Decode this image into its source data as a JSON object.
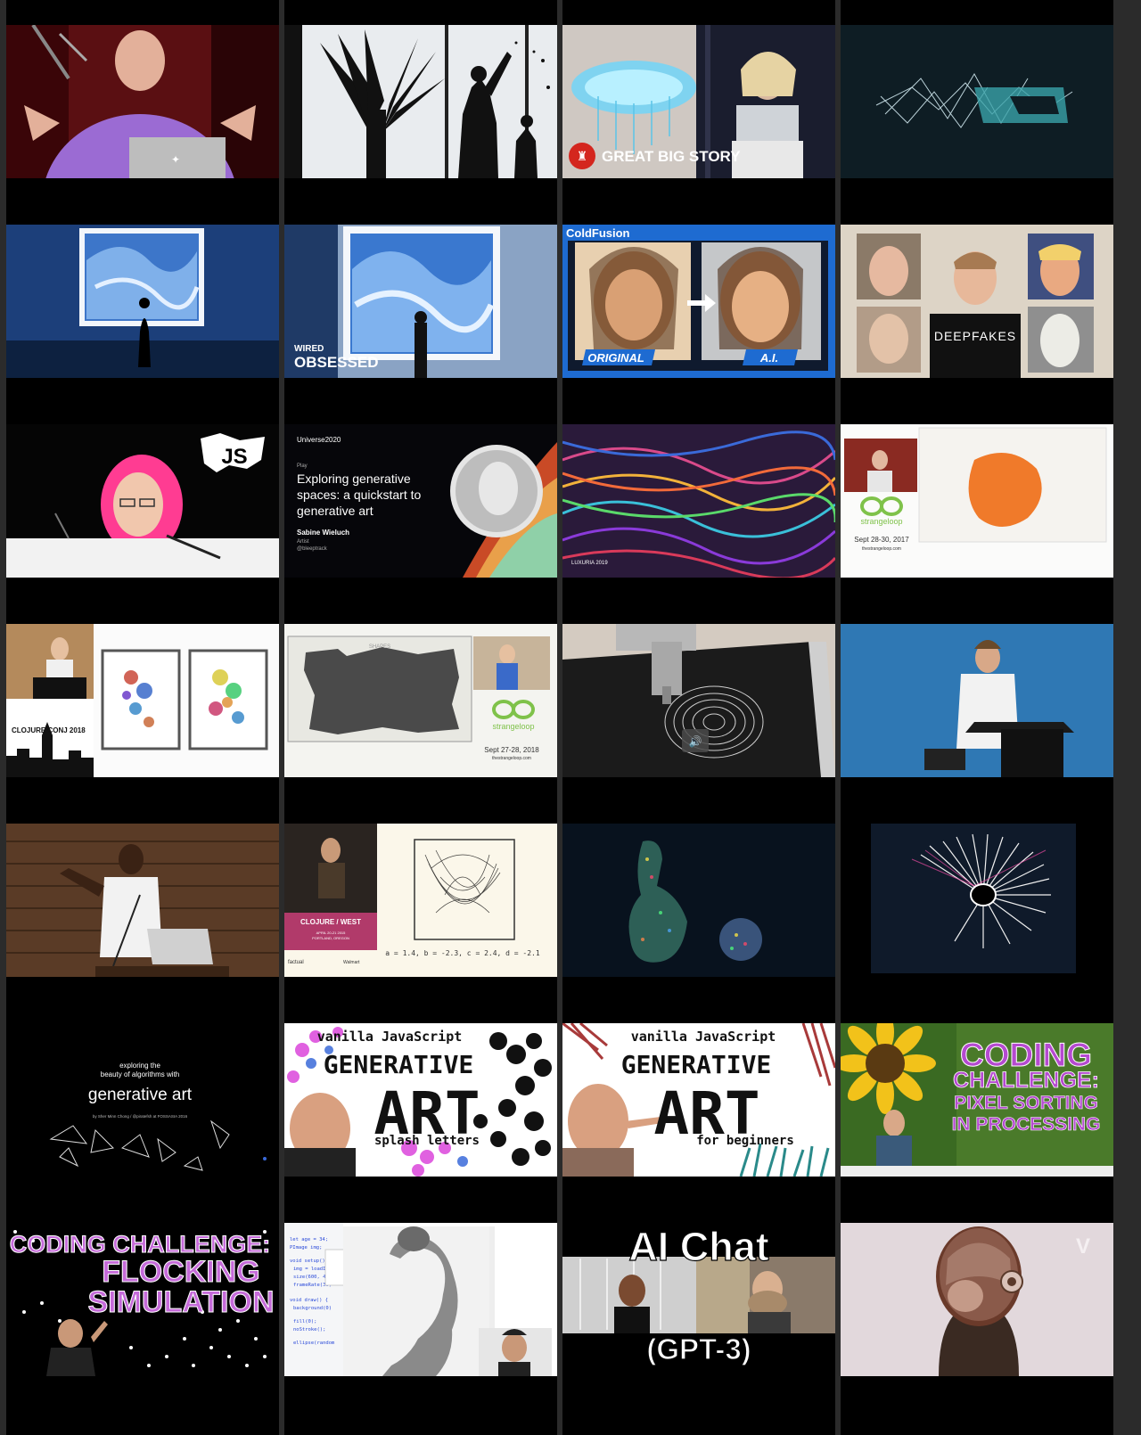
{
  "grid": {
    "tiles": [
      {
        "id": "r1c1",
        "text": []
      },
      {
        "id": "r1c2",
        "text": []
      },
      {
        "id": "r1c3",
        "text": [
          "GREAT BIG STORY"
        ]
      },
      {
        "id": "r1c4",
        "text": []
      },
      {
        "id": "r2c1",
        "text": []
      },
      {
        "id": "r2c2",
        "text": [
          "WIRED",
          "OBSESSED"
        ]
      },
      {
        "id": "r2c3",
        "text": [
          "ColdFusion",
          "ORIGINAL",
          "A.I."
        ]
      },
      {
        "id": "r2c4",
        "text": [
          "DEEPFAKES"
        ]
      },
      {
        "id": "r3c1",
        "text": [
          "JS"
        ]
      },
      {
        "id": "r3c2",
        "text": [
          "Universe2020",
          "Play",
          "Exploring generative",
          "spaces: a quickstart to",
          "generative art",
          "Sabine Wieluch",
          "Artist",
          "@bleeptrack"
        ]
      },
      {
        "id": "r3c3",
        "text": [
          "LUXURIA 2019"
        ]
      },
      {
        "id": "r3c4",
        "text": [
          "strangeloop",
          "Sept 28-30, 2017",
          "thestrangeloop.com"
        ]
      },
      {
        "id": "r4c1",
        "text": [
          "CLOJURE CONJ 2018"
        ]
      },
      {
        "id": "r4c2",
        "text": [
          "SHAPES",
          "strangeloop",
          "Sept 27-28, 2018",
          "thestrangeloop.com"
        ]
      },
      {
        "id": "r4c3",
        "text": []
      },
      {
        "id": "r4c4",
        "text": []
      },
      {
        "id": "r5c1",
        "text": []
      },
      {
        "id": "r5c2",
        "text": [
          "CLOJURE / WEST",
          "APRIL 20-21 2015",
          "PORTLAND, OREGON",
          "factual",
          "Walmart",
          "a = 1.4, b = -2.3, c = 2.4, d = -2.1"
        ]
      },
      {
        "id": "r5c3",
        "text": []
      },
      {
        "id": "r5c4",
        "text": []
      },
      {
        "id": "r6c1",
        "text": [
          "exploring the",
          "beauty of algorithms with",
          "generative art",
          "by Sher Minn Chong / @piratefsh at FOSSASIA 2016"
        ]
      },
      {
        "id": "r6c2",
        "text": [
          "vanilla JavaScript",
          "GENERATIVE",
          "ART",
          "splash letters"
        ]
      },
      {
        "id": "r6c3",
        "text": [
          "vanilla JavaScript",
          "GENERATIVE",
          "ART",
          "for beginners"
        ]
      },
      {
        "id": "r6c4",
        "text": [
          "CODING",
          "CHALLENGE:",
          "PIXEL SORTING",
          "IN PROCESSING"
        ]
      },
      {
        "id": "r7c1",
        "text": [
          "CODING CHALLENGE:",
          "FLOCKING",
          "SIMULATION"
        ]
      },
      {
        "id": "r7c2",
        "text": [
          "let age = 34;",
          "PImage img;",
          "void setup() {",
          "img = loadImage",
          "size(600, 400)",
          "frameRate(30)",
          "void draw() {",
          "background(0)",
          "fill(0);",
          "noStroke();",
          "ellipse(random"
        ]
      },
      {
        "id": "r7c3",
        "text": [
          "AI Chat",
          "(GPT-3)"
        ]
      },
      {
        "id": "r7c4",
        "text": [
          "V"
        ]
      }
    ]
  }
}
